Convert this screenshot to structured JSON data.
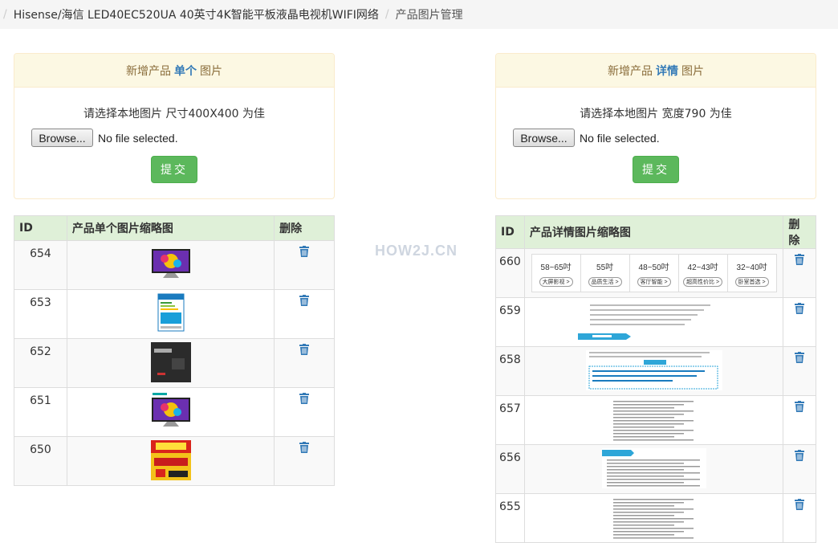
{
  "breadcrumb": {
    "items": [
      "Hisense/海信 LED40EC520UA 40英寸4K智能平板液晶电视机WIFI网络",
      "产品图片管理"
    ]
  },
  "single_panel": {
    "heading_prefix": "新增产品",
    "heading_highlight": "单个",
    "heading_suffix": "图片",
    "hint": "请选择本地图片 尺寸400X400 为佳",
    "browse_label": "Browse...",
    "file_status": "No file selected.",
    "submit_label": "提交"
  },
  "detail_panel": {
    "heading_prefix": "新增产品",
    "heading_highlight": "详情",
    "heading_suffix": "图片",
    "hint": "请选择本地图片 宽度790 为佳",
    "browse_label": "Browse...",
    "file_status": "No file selected.",
    "submit_label": "提交"
  },
  "single_table": {
    "headers": [
      "ID",
      "产品单个图片缩略图",
      "删除"
    ],
    "rows": [
      {
        "id": "654",
        "thumb": "tv-colorful"
      },
      {
        "id": "653",
        "thumb": "energy-label"
      },
      {
        "id": "652",
        "thumb": "tv-back"
      },
      {
        "id": "651",
        "thumb": "tv-colorful-logo"
      },
      {
        "id": "650",
        "thumb": "promo-poster"
      }
    ]
  },
  "detail_table": {
    "headers": [
      "ID",
      "产品详情图片缩略图",
      "删除"
    ],
    "rows": [
      {
        "id": "660",
        "thumb": "size-banner"
      },
      {
        "id": "659",
        "thumb": "text-detail"
      },
      {
        "id": "658",
        "thumb": "notice-box"
      },
      {
        "id": "657",
        "thumb": "dense-text"
      },
      {
        "id": "656",
        "thumb": "list-text"
      },
      {
        "id": "655",
        "thumb": "dense-text"
      }
    ]
  },
  "size_banner": {
    "sizes": [
      "58~65吋",
      "55吋",
      "48~50吋",
      "42~43吋",
      "32~40吋"
    ],
    "tags": [
      "大屏影视",
      "品质生活",
      "客厅智能",
      "超高性价比",
      "卧室首选"
    ]
  },
  "watermark": "HOW2J.CN",
  "colors": {
    "panel_heading_bg": "#fcf8e3",
    "table_header_bg": "#dff0d8",
    "submit_bg": "#5cb85c",
    "trash": "#337ab7"
  }
}
